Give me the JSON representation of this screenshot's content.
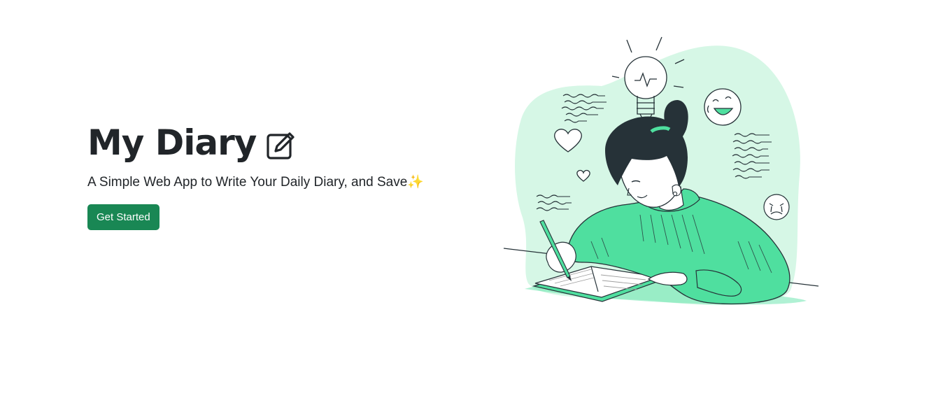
{
  "hero": {
    "title": "My Diary",
    "title_icon": "pencil-square-icon",
    "subtitle": "A Simple Web App to Write Your Daily Diary, and Save",
    "subtitle_emoji": "✨",
    "cta_label": "Get Started"
  },
  "illustration": {
    "name": "girl-writing-diary-illustration"
  },
  "colors": {
    "accent": "#198754",
    "illustration_green": "#4fdf9f",
    "illustration_bg": "#d6f7e6",
    "text": "#212529"
  }
}
